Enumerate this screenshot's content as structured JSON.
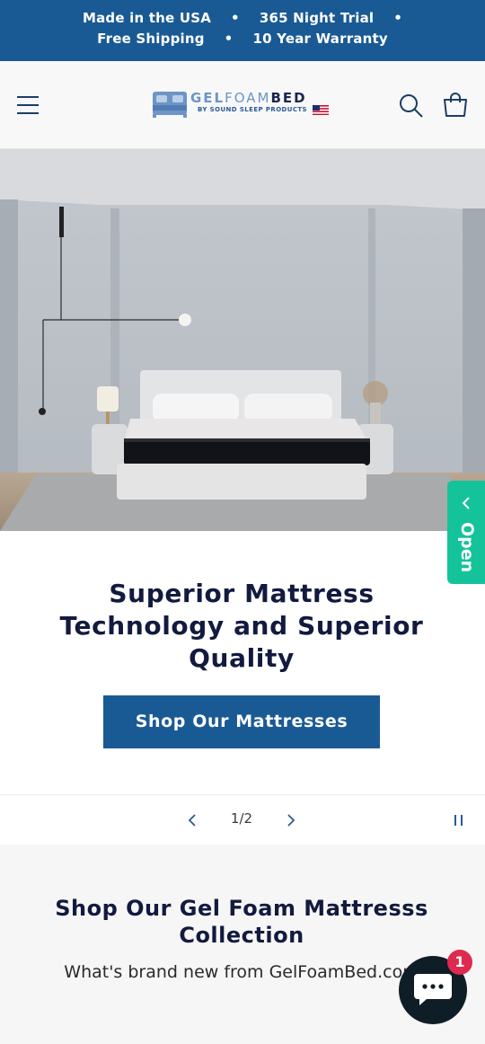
{
  "announcement": {
    "line1": [
      "Made in the USA",
      "365 Night Trial"
    ],
    "line2": [
      "Free Shipping",
      "10 Year Warranty"
    ],
    "separator": "•"
  },
  "header": {
    "logo": {
      "word1": "GEL",
      "word2": "FOAM",
      "word3": "BED",
      "tagline": "BY SOUND SLEEP PRODUCTS"
    },
    "icons": {
      "menu": "hamburger-menu-icon",
      "search": "search-icon",
      "cart": "cart-icon"
    }
  },
  "hero": {
    "title": "Superior Mattress Technology and Superior Quality",
    "cta_label": "Shop Our Mattresses"
  },
  "slider": {
    "counter": "1/2"
  },
  "collection": {
    "title": "Shop Our Gel Foam Mattresss Collection",
    "subtitle": "What's brand new from GelFoamBed.com"
  },
  "side_tab": {
    "label": "Open"
  },
  "chat": {
    "badge_count": "1"
  },
  "colors": {
    "brand_blue": "#1a5a94",
    "navy_text": "#121a3f",
    "tab_green": "#15c39a",
    "badge_red": "#e0294f"
  }
}
